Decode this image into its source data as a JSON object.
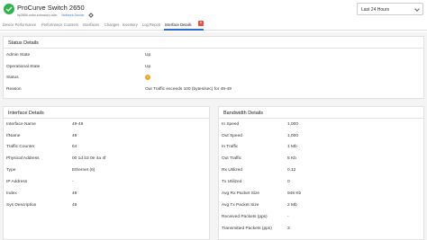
{
  "header": {
    "title": "ProCurve Switch 2650",
    "host": "hp2650.zoho.zohocorp.com",
    "badge": "Network Device",
    "time_range": "Last 24 Hours"
  },
  "tabs": [
    {
      "label": "Device Performance"
    },
    {
      "label": "Performance Counters"
    },
    {
      "label": "Interfaces"
    },
    {
      "label": "Changes"
    },
    {
      "label": "Inventory"
    },
    {
      "label": "Log Report"
    },
    {
      "label": "Interface Details"
    }
  ],
  "status_details": {
    "heading": "Status Details",
    "rows": [
      {
        "label": "Admin State",
        "value": "Up"
      },
      {
        "label": "Operational State",
        "value": "Up"
      },
      {
        "label": "Status",
        "value": ""
      },
      {
        "label": "Reason",
        "value": "Out Traffic exceeds 100 (bytes/sec) for 49-49"
      }
    ]
  },
  "interface_details": {
    "heading": "Interface Details",
    "rows": [
      {
        "label": "Interface Name",
        "value": "49-49"
      },
      {
        "label": "IfName",
        "value": "49"
      },
      {
        "label": "Traffic Counter",
        "value": "64"
      },
      {
        "label": "Physical Address",
        "value": "00 1d b3 0e 4a 4f"
      },
      {
        "label": "Type",
        "value": "Ethernet (6)"
      },
      {
        "label": "IP Address",
        "value": "-"
      },
      {
        "label": "Index",
        "value": "49"
      },
      {
        "label": "Sys Description",
        "value": "49"
      }
    ]
  },
  "bandwidth_details": {
    "heading": "Bandwidth Details",
    "rows": [
      {
        "label": "In Speed",
        "value": "1,000"
      },
      {
        "label": "Out Speed",
        "value": "1,000"
      },
      {
        "label": "In Traffic",
        "value": "1 Mb"
      },
      {
        "label": "Out Traffic",
        "value": "5 Kb"
      },
      {
        "label": "Rx Utilized",
        "value": "0.12"
      },
      {
        "label": "Tx Utilized",
        "value": "0"
      },
      {
        "label": "Avg Rx Packet Size",
        "value": "948 Kb"
      },
      {
        "label": "Avg Tx Packet Size",
        "value": "2 Mb"
      },
      {
        "label": "Received Packets (pps)",
        "value": "-"
      },
      {
        "label": "Transmitted Packets (pps)",
        "value": "3"
      }
    ]
  },
  "colors": {
    "accent": "#2f6fc9",
    "logo": "#2fb34a",
    "warning": "#f2a31b",
    "close": "#e74c3c"
  }
}
